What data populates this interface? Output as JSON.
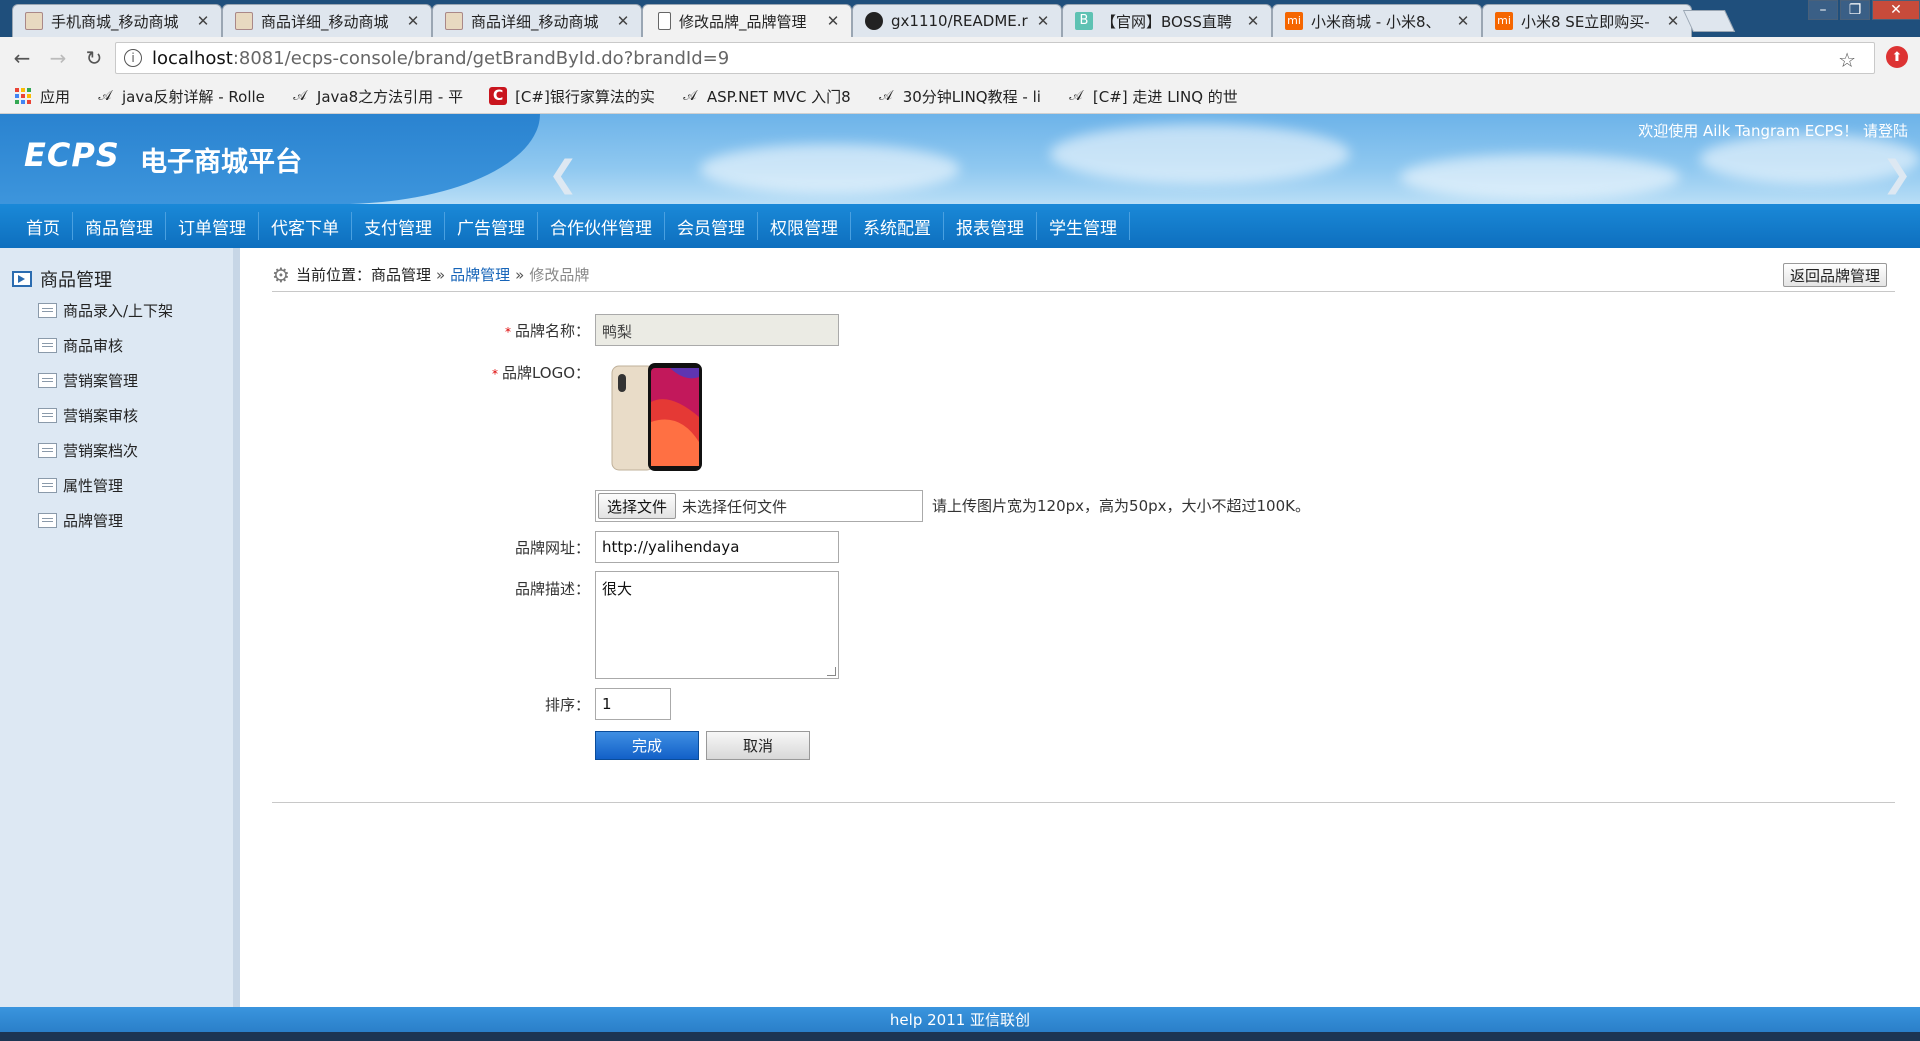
{
  "browser": {
    "tabs": [
      {
        "title": "手机商城_移动商城",
        "icon": "page-thumb-icon",
        "active": false
      },
      {
        "title": "商品详细_移动商城",
        "icon": "page-thumb-icon",
        "active": false
      },
      {
        "title": "商品详细_移动商城",
        "icon": "page-thumb-icon",
        "active": false
      },
      {
        "title": "修改品牌_品牌管理",
        "icon": "document-icon",
        "active": true
      },
      {
        "title": "gx1110/README.r",
        "icon": "github-icon",
        "active": false
      },
      {
        "title": "【官网】BOSS直聘",
        "icon": "boss-icon",
        "active": false
      },
      {
        "title": "小米商城 - 小米8、",
        "icon": "mi-icon",
        "active": false
      },
      {
        "title": "小米8 SE立即购买-",
        "icon": "mi-icon",
        "active": false
      }
    ],
    "url_host": "localhost",
    "url_path": ":8081/ecps-console/brand/getBrandById.do?brandId=9",
    "bookmarks": [
      {
        "label": "应用",
        "icon": "apps-icon"
      },
      {
        "label": "java反射详解 - Rolle",
        "icon": "bookmark-icon"
      },
      {
        "label": "Java8之方法引用 - 平",
        "icon": "bookmark-icon"
      },
      {
        "label": "[C#]银行家算法的实",
        "icon": "csdn-icon"
      },
      {
        "label": "ASP.NET MVC 入门8",
        "icon": "bookmark-icon"
      },
      {
        "label": "30分钟LINQ教程 - li",
        "icon": "bookmark-icon"
      },
      {
        "label": "[C#] 走进 LINQ 的世",
        "icon": "bookmark-icon"
      }
    ]
  },
  "header": {
    "logo": "ECPS",
    "platform": "电子商城平台",
    "welcome": "欢迎使用 Ailk Tangram ECPS！ 请登陆"
  },
  "nav": [
    "首页",
    "商品管理",
    "订单管理",
    "代客下单",
    "支付管理",
    "广告管理",
    "合作伙伴管理",
    "会员管理",
    "权限管理",
    "系统配置",
    "报表管理",
    "学生管理"
  ],
  "sidebar": {
    "title": "商品管理",
    "items": [
      "商品录入/上下架",
      "商品审核",
      "营销案管理",
      "营销案审核",
      "营销案档次",
      "属性管理",
      "品牌管理"
    ]
  },
  "breadcrumb": {
    "prefix": "当前位置：",
    "level1": "商品管理",
    "level2": "品牌管理",
    "current": "修改品牌",
    "separator": "»"
  },
  "back_button": "返回品牌管理",
  "form": {
    "name_label": "品牌名称：",
    "name_value": "鸭梨",
    "logo_label": "品牌LOGO：",
    "file_button": "选择文件",
    "file_status": "未选择任何文件",
    "upload_hint": "请上传图片宽为120px，高为50px，大小不超过100K。",
    "url_label": "品牌网址：",
    "url_value": "http://yalihendaya",
    "desc_label": "品牌描述：",
    "desc_value": "很大",
    "sort_label": "排序：",
    "sort_value": "1",
    "submit": "完成",
    "cancel": "取消"
  },
  "footer": "help 2011 亚信联创",
  "colors": {
    "brand_blue": "#1664b8",
    "nav_bg": "#0e6fbe",
    "sidebar_bg": "#dde8f3",
    "required": "#dd0000"
  }
}
